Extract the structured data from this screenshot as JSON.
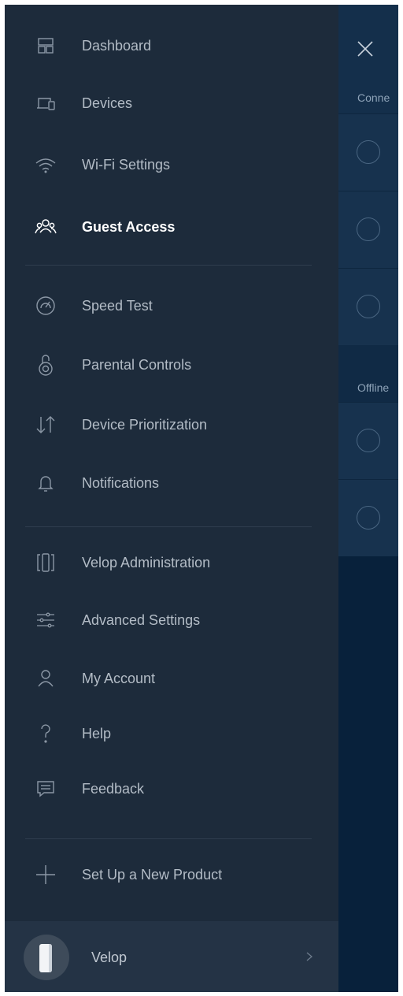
{
  "under": {
    "section_connected": "Conne",
    "section_offline": "Offline"
  },
  "menu": {
    "items": [
      {
        "label": "Dashboard",
        "icon": "dashboard-icon"
      },
      {
        "label": "Devices",
        "icon": "devices-icon"
      },
      {
        "label": "Wi-Fi Settings",
        "icon": "wifi-icon"
      },
      {
        "label": "Guest Access",
        "icon": "guests-icon",
        "active": true
      },
      {
        "label": "Speed Test",
        "icon": "speedometer-icon"
      },
      {
        "label": "Parental Controls",
        "icon": "lock-icon"
      },
      {
        "label": "Device Prioritization",
        "icon": "priority-arrows-icon"
      },
      {
        "label": "Notifications",
        "icon": "bell-icon"
      },
      {
        "label": "Velop Administration",
        "icon": "velop-node-icon"
      },
      {
        "label": "Advanced Settings",
        "icon": "sliders-icon"
      },
      {
        "label": "My Account",
        "icon": "person-icon"
      },
      {
        "label": "Help",
        "icon": "question-icon"
      },
      {
        "label": "Feedback",
        "icon": "chat-bubble-icon"
      },
      {
        "label": "Set Up a New Product",
        "icon": "plus-icon"
      }
    ]
  },
  "footer": {
    "label": "Velop"
  }
}
